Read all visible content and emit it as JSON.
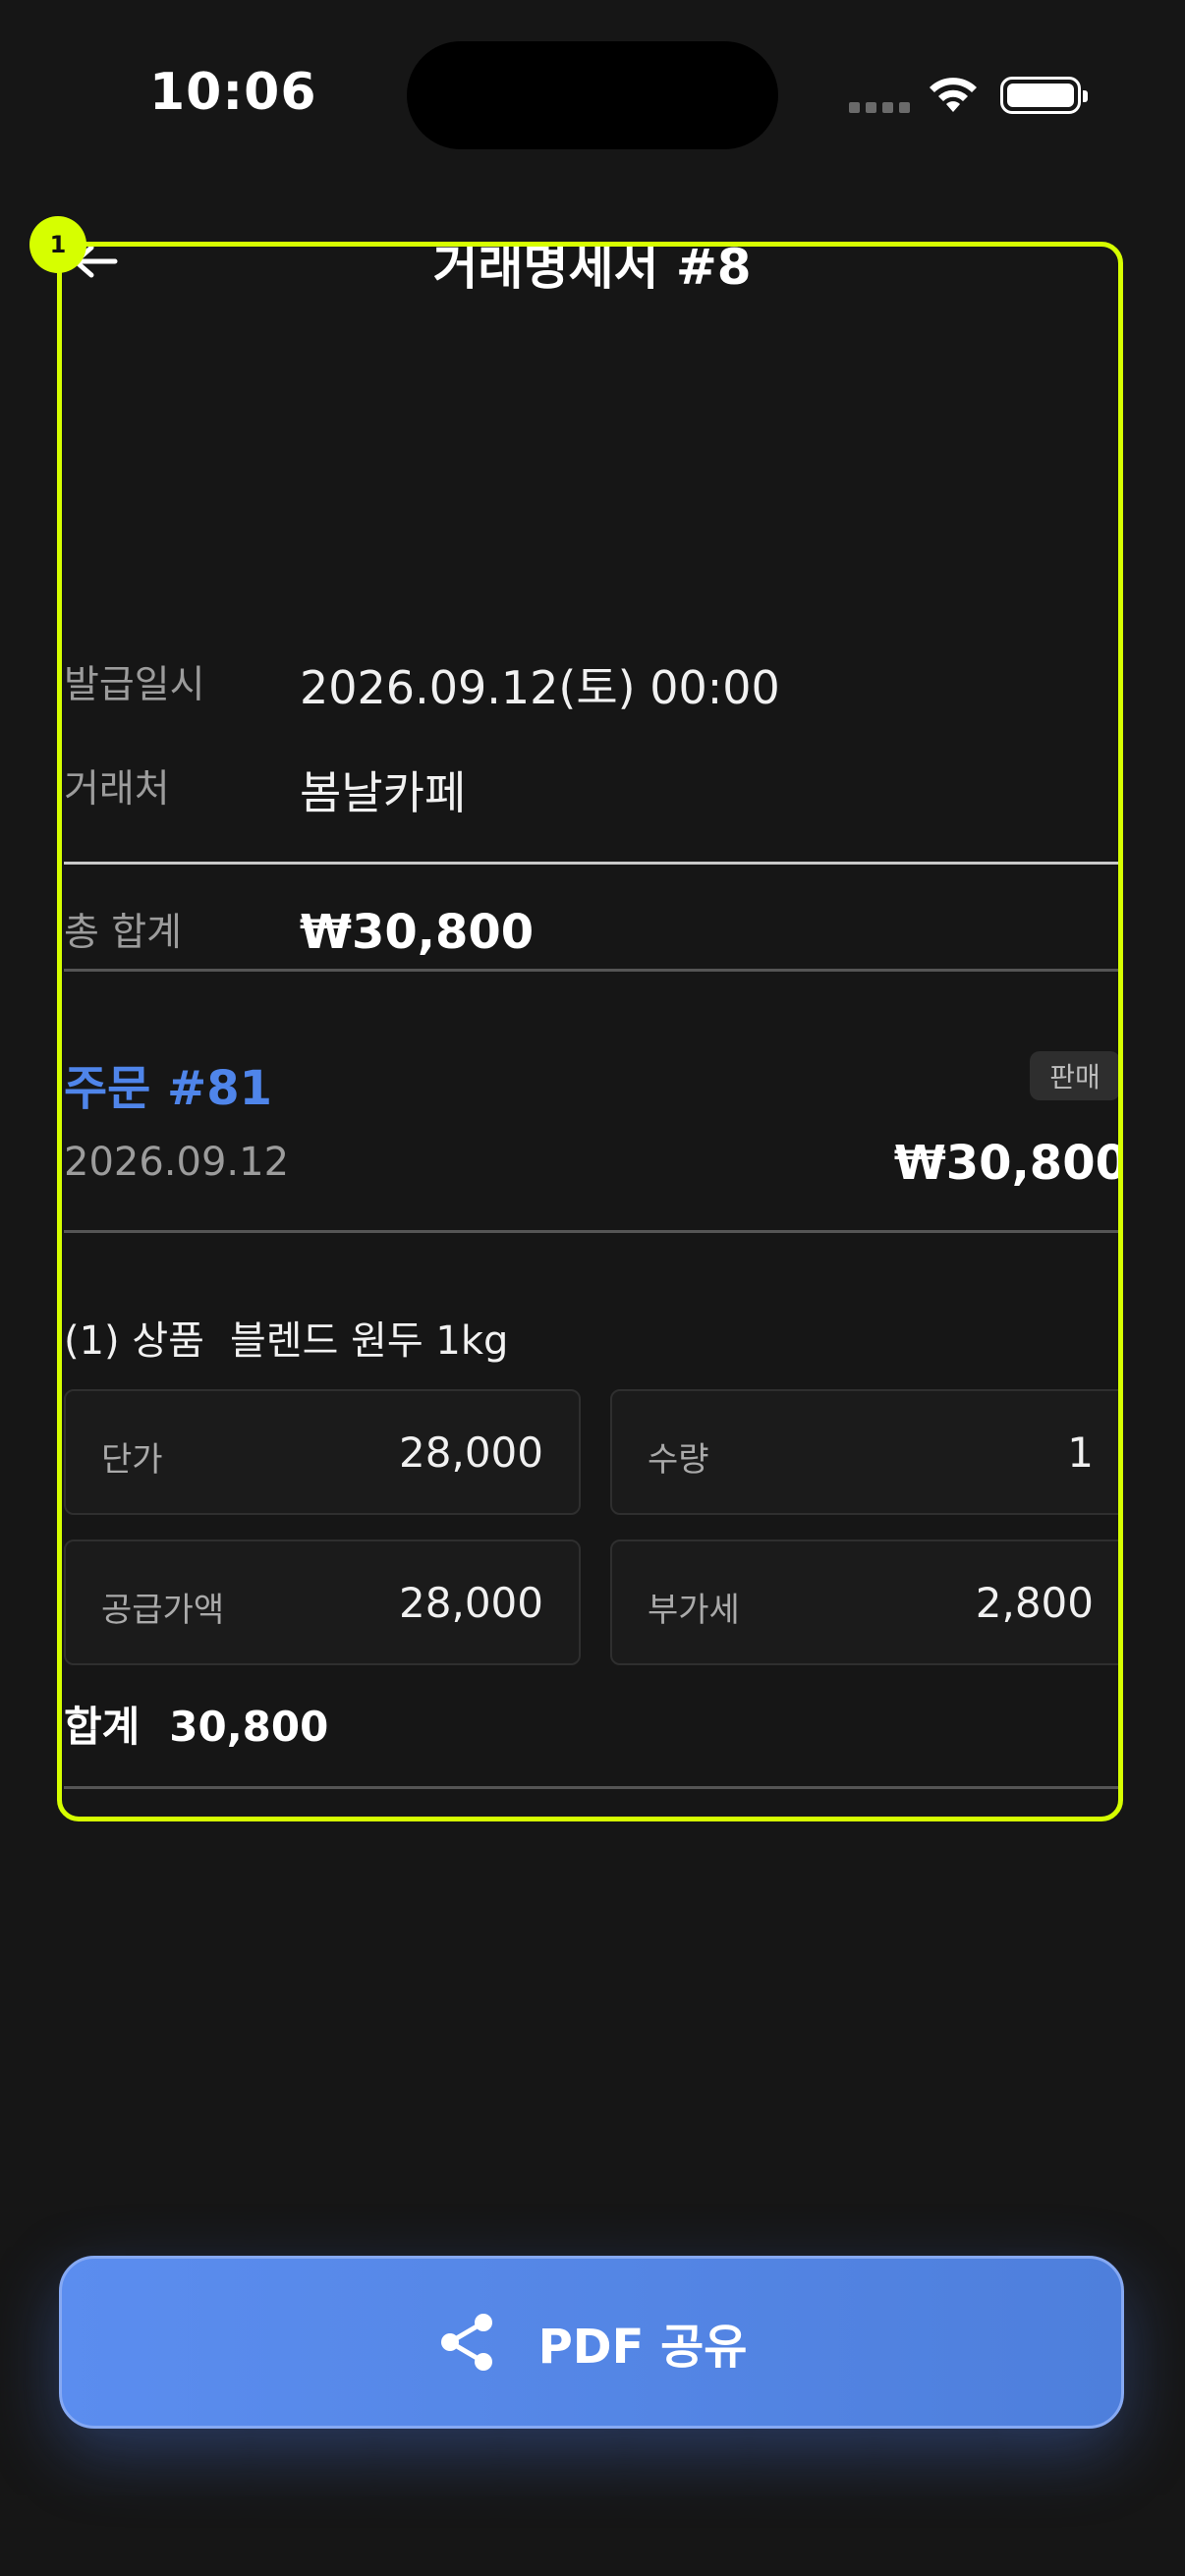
{
  "status_bar": {
    "time": "10:06"
  },
  "annotation": {
    "marker": "1",
    "accent": "#d6ff00"
  },
  "header": {
    "title": "거래명세서 #8",
    "back_icon": "arrow-left-icon"
  },
  "info": {
    "issued_label": "발급일시",
    "issued_value": "2026.09.12(토) 00:00",
    "client_label": "거래처",
    "client_value": "봄날카페"
  },
  "summary": {
    "total_label": "총 합계",
    "total_value": "₩30,800"
  },
  "order": {
    "title": "주문 #81",
    "type_badge": "판매",
    "date": "2026.09.12",
    "amount": "₩30,800",
    "accent": "#4f85ea"
  },
  "item": {
    "index": "(1) 상품",
    "name": "블렌드 원두 1kg",
    "unit_price_label": "단가",
    "unit_price": "28,000",
    "quantity_label": "수량",
    "quantity": "1",
    "supply_label": "공급가액",
    "supply_value": "28,000",
    "vat_label": "부가세",
    "vat_value": "2,800",
    "total_label": "합계",
    "total_value": "30,800"
  },
  "actions": {
    "share_label": "PDF 공유",
    "share_icon": "share-icon",
    "color": "#5b8def"
  }
}
